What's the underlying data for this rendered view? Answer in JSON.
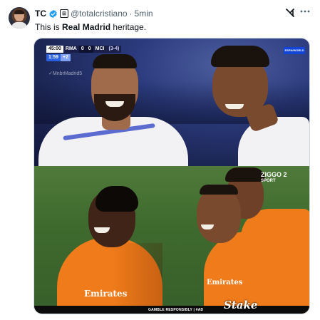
{
  "tweet": {
    "author_name": "TC",
    "affiliate_badge": "⊞",
    "handle": "@totalcristiano",
    "separator": "·",
    "timestamp": "5min",
    "text_prefix": "This is ",
    "text_bold": "Real Madrid",
    "text_suffix": " heritage.",
    "grok_icon": "grok-icon",
    "more_icon": "more-icon",
    "verified_color": "#1d9bf0"
  },
  "media": {
    "scoreboard": {
      "time": "45:00",
      "home": "RMA",
      "home_score": "0",
      "away_score": "0",
      "away": "MCI",
      "aggregate": "(3-4)",
      "extra_time": "1:59",
      "added": "+2"
    },
    "watermark": "✓MnbrMadrid5",
    "broadcaster_badge": "ESPN/WORLD",
    "ziggo_line1": "ZIGGO",
    "ziggo_line2": "SPORT",
    "ziggo_num": "2",
    "sponsor_1": "Emirates",
    "sponsor_2": "Emirates",
    "gamble_text": "GAMBLE RESPONSIBLY | #AD",
    "stake_logo": "Stake"
  }
}
